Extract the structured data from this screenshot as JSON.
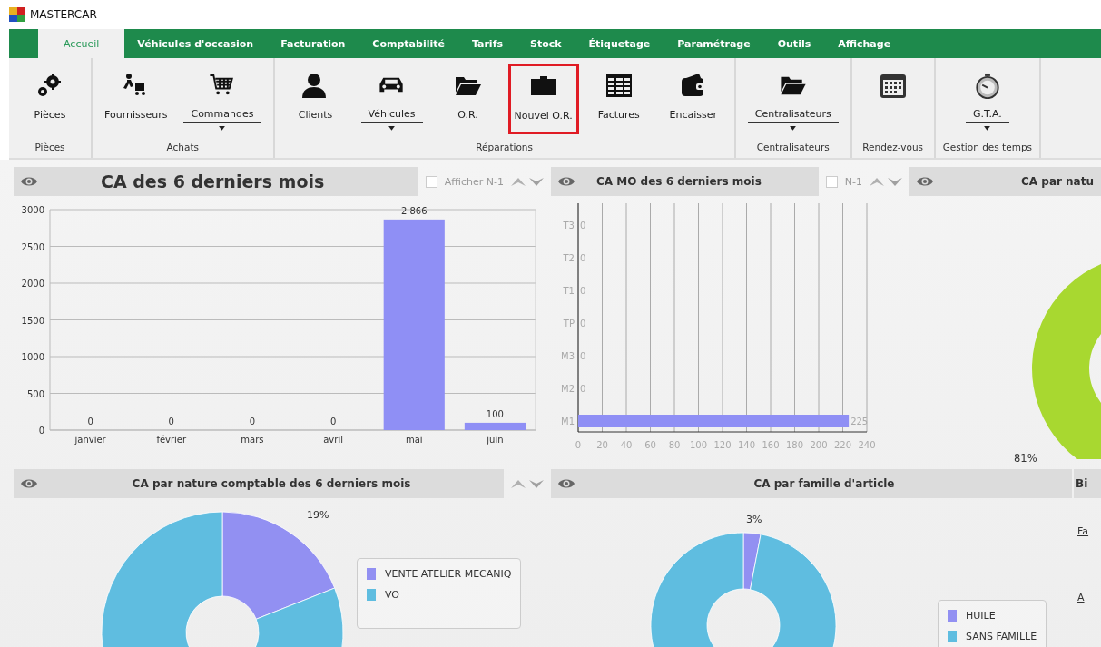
{
  "title_bar": {
    "title": "MASTERCAR"
  },
  "tabs": [
    {
      "label": "Accueil",
      "selected": true
    },
    {
      "label": "Véhicules d'occasion",
      "selected": false
    },
    {
      "label": "Facturation",
      "selected": false
    },
    {
      "label": "Comptabilité",
      "selected": false
    },
    {
      "label": "Tarifs",
      "selected": false
    },
    {
      "label": "Stock",
      "selected": false
    },
    {
      "label": "Étiquetage",
      "selected": false
    },
    {
      "label": "Paramétrage",
      "selected": false
    },
    {
      "label": "Outils",
      "selected": false
    },
    {
      "label": "Affichage",
      "selected": false
    }
  ],
  "ribbon": {
    "groups": [
      {
        "label": "Pièces",
        "buttons": [
          {
            "kind": "gears",
            "label": "Pièces",
            "dropdown": false,
            "highlighted": false
          }
        ]
      },
      {
        "label": "Achats",
        "buttons": [
          {
            "kind": "delivery",
            "label": "Fournisseurs",
            "dropdown": false,
            "highlighted": false
          },
          {
            "kind": "cart",
            "label": "Commandes",
            "dropdown": true,
            "highlighted": false
          }
        ]
      },
      {
        "label": "Réparations",
        "buttons": [
          {
            "kind": "person",
            "label": "Clients",
            "dropdown": false,
            "highlighted": false
          },
          {
            "kind": "car",
            "label": "Véhicules",
            "dropdown": true,
            "highlighted": false
          },
          {
            "kind": "folder-open",
            "label": "O.R.",
            "dropdown": false,
            "highlighted": false
          },
          {
            "kind": "folder",
            "label": "Nouvel O.R.",
            "dropdown": false,
            "highlighted": true
          },
          {
            "kind": "table",
            "label": "Factures",
            "dropdown": false,
            "highlighted": false
          },
          {
            "kind": "wallet",
            "label": "Encaisser",
            "dropdown": false,
            "highlighted": false
          }
        ]
      },
      {
        "label": "Centralisateurs",
        "buttons": [
          {
            "kind": "folder-open",
            "label": "Centralisateurs",
            "dropdown": true,
            "highlighted": false
          }
        ]
      },
      {
        "label": "Rendez-vous",
        "buttons": [
          {
            "kind": "calendar",
            "dropdown": false,
            "highlighted": false
          }
        ]
      },
      {
        "label": "Gestion des temps",
        "buttons": [
          {
            "kind": "stopwatch",
            "label": "G.T.A.",
            "dropdown": true,
            "highlighted": false
          }
        ]
      }
    ]
  },
  "panels": [
    {
      "kind": "chart",
      "title": "CA des 6 derniers mois",
      "toggle": {
        "label": "Afficher N-1",
        "checked": false
      },
      "sort_arrows": true,
      "chart_data": {
        "type": "bar",
        "categories": [
          "janvier",
          "février",
          "mars",
          "avril",
          "mai",
          "juin"
        ],
        "values": [
          0,
          0,
          0,
          0,
          2866,
          100
        ],
        "color": "#8f8ff5",
        "ylim": [
          0,
          3000
        ],
        "yticks": [
          0,
          500,
          1000,
          1500,
          2000,
          2500,
          3000
        ],
        "value_labels": [
          "0",
          "0",
          "0",
          "0",
          "2 866",
          "100"
        ],
        "grid": true
      }
    },
    {
      "kind": "chart",
      "title": "CA MO des 6 derniers mois",
      "toggle": {
        "label": "N-1",
        "checked": false
      },
      "sort_arrows": true,
      "chart_data": {
        "type": "bar",
        "orientation": "horizontal",
        "categories": [
          "T3",
          "T2",
          "T1",
          "TP",
          "M3",
          "M2",
          "M1"
        ],
        "values": [
          0,
          0,
          0,
          0,
          0,
          0,
          225
        ],
        "color": "#8f8ff5",
        "xlim": [
          0,
          240
        ],
        "xticks": [
          0,
          20,
          40,
          60,
          80,
          100,
          120,
          140,
          160,
          180,
          200,
          220,
          240
        ],
        "value_labels": [
          "0",
          "0",
          "0",
          "0",
          "0",
          "0",
          "225"
        ],
        "grid": true
      }
    },
    {
      "kind": "donut-picture",
      "title": "CA par natu",
      "percent_label": "81%",
      "color": "#a8d830"
    },
    {
      "kind": "chart",
      "title": "CA par nature comptable des 6 derniers mois",
      "sort_arrows": true,
      "chart_data": {
        "type": "donut",
        "categories": [
          "VENTE ATELIER MECANIQ",
          "VO"
        ],
        "values": [
          19,
          81
        ],
        "colors": [
          "#9290f2",
          "#5fbde0"
        ],
        "value_labels": [
          "19%",
          null
        ]
      }
    },
    {
      "kind": "chart",
      "title": "CA par famille d'article",
      "chart_data": {
        "type": "donut",
        "categories": [
          "HUILE",
          "SANS FAMILLE"
        ],
        "values": [
          3,
          97
        ],
        "colors": [
          "#9290f2",
          "#5fbde0"
        ],
        "value_labels": [
          "3%",
          null
        ]
      }
    },
    {
      "kind": "links",
      "title": "Bi",
      "links": [
        "Fa",
        "A"
      ]
    }
  ]
}
